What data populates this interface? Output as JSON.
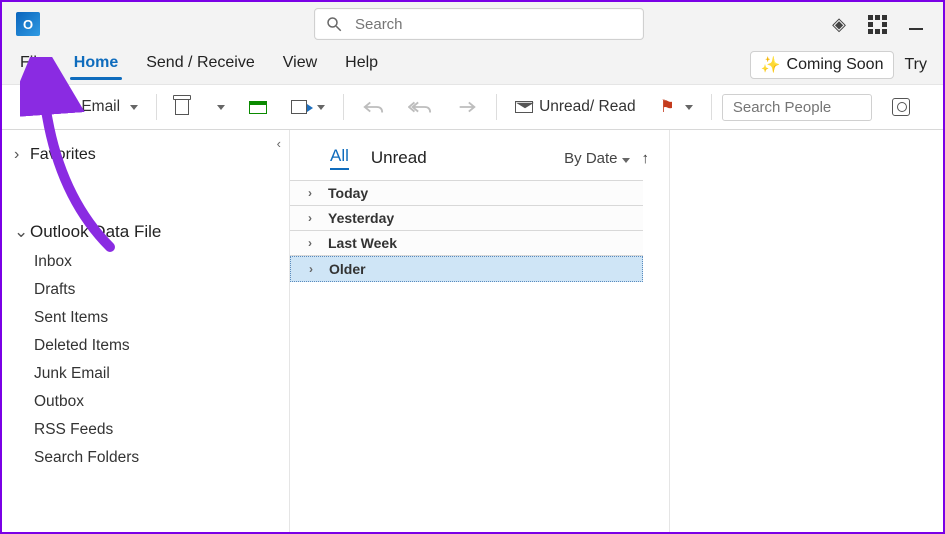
{
  "titlebar": {
    "search_placeholder": "Search"
  },
  "menubar": {
    "items": [
      "File",
      "Home",
      "Send / Receive",
      "View",
      "Help"
    ],
    "active_index": 1,
    "coming_soon": "Coming Soon",
    "try": "Try"
  },
  "toolbar": {
    "new_email": "New Email",
    "unread_read": "Unread/ Read",
    "search_people_placeholder": "Search People"
  },
  "nav": {
    "favorites": "Favorites",
    "data_file": "Outlook Data File",
    "folders": [
      "Inbox",
      "Drafts",
      "Sent Items",
      "Deleted Items",
      "Junk Email",
      "Outbox",
      "RSS Feeds",
      "Search Folders"
    ]
  },
  "message_list": {
    "filters": {
      "all": "All",
      "unread": "Unread"
    },
    "sort_label": "By Date",
    "groups": [
      "Today",
      "Yesterday",
      "Last Week",
      "Older"
    ],
    "selected_group_index": 3
  }
}
